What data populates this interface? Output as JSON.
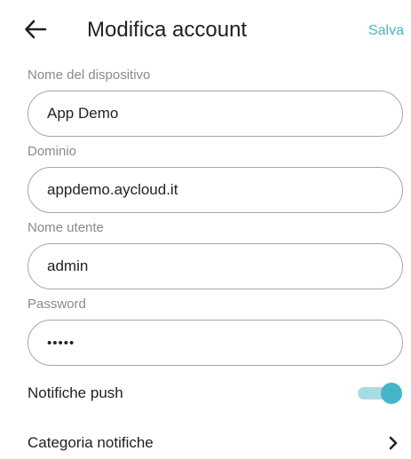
{
  "header": {
    "back_icon": "arrow-left-icon",
    "title": "Modifica account",
    "save_label": "Salva"
  },
  "form": {
    "device_name": {
      "label": "Nome del dispositivo",
      "value": "App Demo"
    },
    "domain": {
      "label": "Dominio",
      "value": "appdemo.aycloud.it"
    },
    "username": {
      "label": "Nome utente",
      "value": "admin"
    },
    "password": {
      "label": "Password",
      "value": "•••••"
    }
  },
  "settings": {
    "push_notifications": {
      "label": "Notifiche push",
      "enabled": true
    },
    "notification_categories": {
      "label": "Categoria notifiche",
      "icon": "chevron-right-icon"
    }
  },
  "colors": {
    "accent": "#45b6c7",
    "accent_light": "#a6dde3",
    "field_border": "#a6a6a6",
    "label_gray": "#8a8a8a"
  }
}
